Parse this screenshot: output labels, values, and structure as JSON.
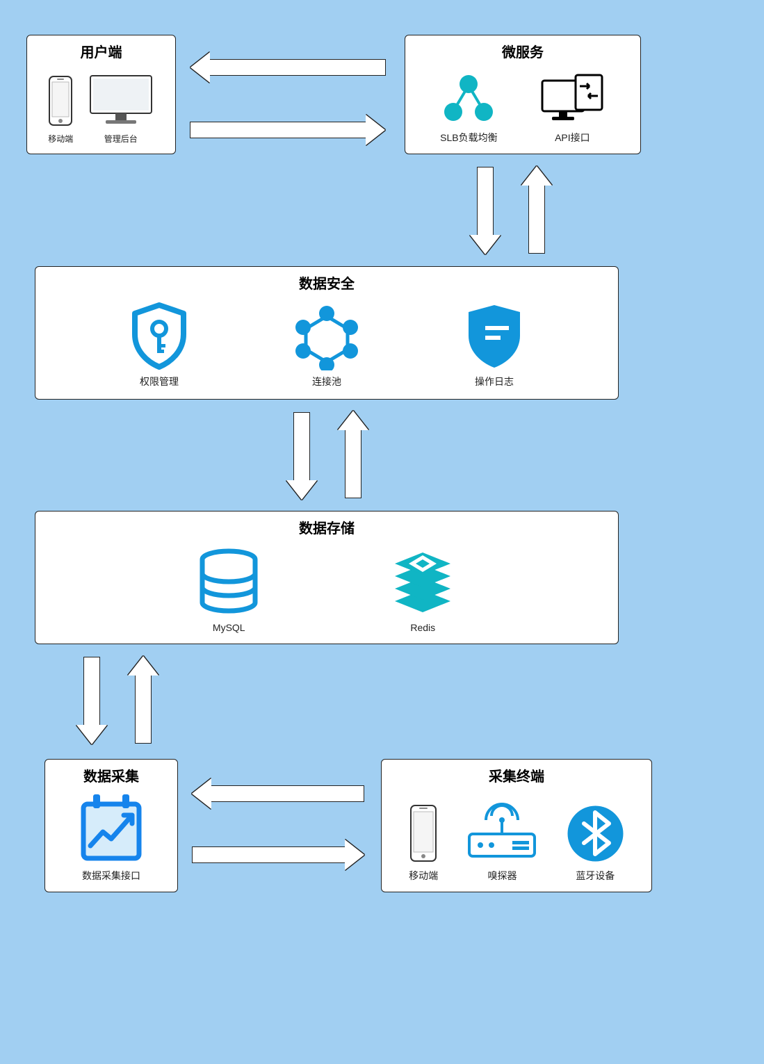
{
  "boxes": {
    "client": {
      "title": "用户端",
      "items": [
        {
          "id": "mobile",
          "label": "移动端"
        },
        {
          "id": "admin",
          "label": "管理后台"
        }
      ]
    },
    "microservice": {
      "title": "微服务",
      "items": [
        {
          "id": "slb",
          "label": "SLB负载均衡"
        },
        {
          "id": "api",
          "label": "API接口"
        }
      ]
    },
    "security": {
      "title": "数据安全",
      "items": [
        {
          "id": "perm",
          "label": "权限管理"
        },
        {
          "id": "pool",
          "label": "连接池"
        },
        {
          "id": "log",
          "label": "操作日志"
        }
      ]
    },
    "storage": {
      "title": "数据存储",
      "items": [
        {
          "id": "mysql",
          "label": "MySQL"
        },
        {
          "id": "redis",
          "label": "Redis"
        }
      ]
    },
    "collect": {
      "title": "数据采集",
      "items": [
        {
          "id": "api",
          "label": "数据采集接口"
        }
      ]
    },
    "terminal": {
      "title": "采集终端",
      "items": [
        {
          "id": "mobile",
          "label": "移动端"
        },
        {
          "id": "sniffer",
          "label": "嗅探器"
        },
        {
          "id": "bt",
          "label": "蓝牙设备"
        }
      ]
    }
  },
  "colors": {
    "accent": "#1296db",
    "teal": "#10b5c4"
  }
}
